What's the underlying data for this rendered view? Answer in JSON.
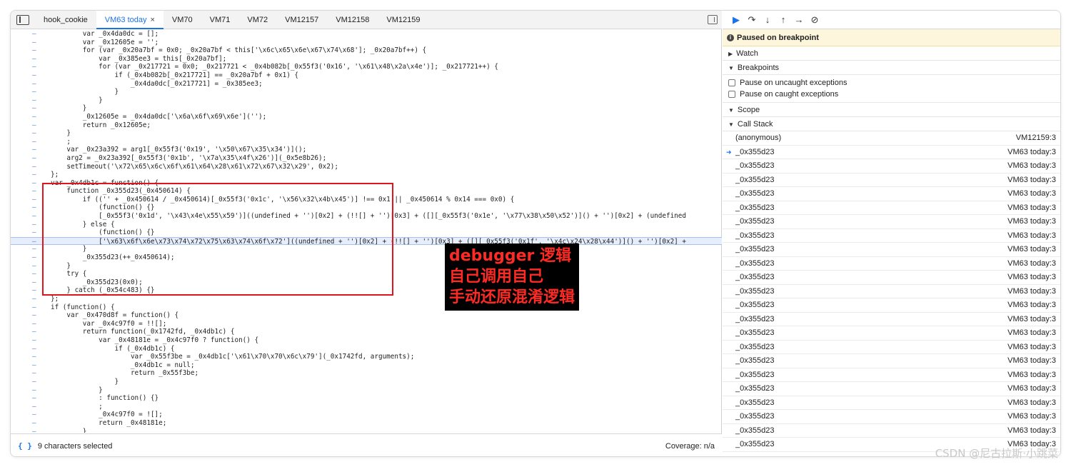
{
  "tabs": [
    {
      "label": "hook_cookie",
      "active": false
    },
    {
      "label": "VM63 today",
      "active": true
    },
    {
      "label": "VM70",
      "active": false
    },
    {
      "label": "VM71",
      "active": false
    },
    {
      "label": "VM72",
      "active": false
    },
    {
      "label": "VM12157",
      "active": false
    },
    {
      "label": "VM12158",
      "active": false
    },
    {
      "label": "VM12159",
      "active": false
    }
  ],
  "tab_close": "×",
  "code_lines": [
    {
      "text": "        var _0x4da0dc = [];"
    },
    {
      "text": "        var _0x12605e = '';"
    },
    {
      "text": "        for (var _0x20a7bf = 0x0; _0x20a7bf < this['\\x6c\\x65\\x6e\\x67\\x74\\x68']; _0x20a7bf++) {"
    },
    {
      "text": "            var _0x385ee3 = this[_0x20a7bf];"
    },
    {
      "text": "            for (var _0x217721 = 0x0; _0x217721 < _0x4b082b[_0x55f3('0x16', '\\x61\\x48\\x2a\\x4e')]; _0x217721++) {"
    },
    {
      "text": "                if (_0x4b082b[_0x217721] == _0x20a7bf + 0x1) {"
    },
    {
      "text": "                    _0x4da0dc[_0x217721] = _0x385ee3;"
    },
    {
      "text": "                }"
    },
    {
      "text": "            }"
    },
    {
      "text": "        }"
    },
    {
      "text": "        _0x12605e = _0x4da0dc['\\x6a\\x6f\\x69\\x6e']('');"
    },
    {
      "text": "        return _0x12605e;"
    },
    {
      "text": "    }"
    },
    {
      "text": "    ;"
    },
    {
      "text": "    var _0x23a392 = arg1[_0x55f3('0x19', '\\x50\\x67\\x35\\x34')]();"
    },
    {
      "text": "    arg2 = _0x23a392[_0x55f3('0x1b', '\\x7a\\x35\\x4f\\x26')](_0x5e8b26);"
    },
    {
      "text": "    setTimeout('\\x72\\x65\\x6c\\x6f\\x61\\x64\\x28\\x61\\x72\\x67\\x32\\x29', 0x2);"
    },
    {
      "text": "};"
    },
    {
      "text": "var _0x4db1c = function() {"
    },
    {
      "text": "    function _0x355d23(_0x450614) {"
    },
    {
      "text": "        if (('' + _0x450614 / _0x450614)[_0x55f3('0x1c', '\\x56\\x32\\x4b\\x45')] !== 0x1 || _0x450614 % 0x14 === 0x0) {"
    },
    {
      "text": "            (function() {}"
    },
    {
      "text": "            [_0x55f3('0x1d', '\\x43\\x4e\\x55\\x59')]((undefined + '')[0x2] + (!![] + '')[0x3] + ([][_0x55f3('0x1e', '\\x77\\x38\\x50\\x52')]() + '')[0x2] + (undefined"
    },
    {
      "text": "        } else {"
    },
    {
      "text": "            (function() {}"
    },
    {
      "text": "            ['\\x63\\x6f\\x6e\\x73\\x74\\x72\\x75\\x63\\x74\\x6f\\x72']((undefined + '')[0x2] + (!![] + '')[0x3] + ([][_0x55f3('0x1f', '\\x4c\\x24\\x28\\x44')]() + '')[0x2] +",
      "highlight": true
    },
    {
      "text": "        }"
    },
    {
      "text": "        _0x355d23(++_0x450614);"
    },
    {
      "text": "    }"
    },
    {
      "text": "    try {"
    },
    {
      "text": "        _0x355d23(0x0);"
    },
    {
      "text": "    } catch (_0x54c483) {}"
    },
    {
      "text": "};"
    },
    {
      "text": "if (function() {"
    },
    {
      "text": "    var _0x470d8f = function() {"
    },
    {
      "text": "        var _0x4c97f0 = !![];"
    },
    {
      "text": "        return function(_0x1742fd, _0x4db1c) {"
    },
    {
      "text": "            var _0x48181e = _0x4c97f0 ? function() {"
    },
    {
      "text": "                if (_0x4db1c) {"
    },
    {
      "text": "                    var _0x55f3be = _0x4db1c['\\x61\\x70\\x70\\x6c\\x79'](_0x1742fd, arguments);"
    },
    {
      "text": "                    _0x4db1c = null;"
    },
    {
      "text": "                    return _0x55f3be;"
    },
    {
      "text": "                }"
    },
    {
      "text": "            }"
    },
    {
      "text": "            : function() {}"
    },
    {
      "text": "            ;"
    },
    {
      "text": "            _0x4c97f0 = ![];"
    },
    {
      "text": "            return _0x48181e;"
    },
    {
      "text": "        }"
    }
  ],
  "gutter_mark": "–",
  "annotation": {
    "line1": "debugger 逻辑",
    "line2": "自己调用自己",
    "line3": "手动还原混淆逻辑"
  },
  "statusbar": {
    "braces": "{ }",
    "selection": "9 characters selected",
    "coverage": "Coverage: n/a"
  },
  "right_panel": {
    "paused_text": "Paused on breakpoint",
    "watch": "Watch",
    "breakpoints": "Breakpoints",
    "pause_uncaught": "Pause on uncaught exceptions",
    "pause_caught": "Pause on caught exceptions",
    "scope": "Scope",
    "call_stack": "Call Stack"
  },
  "call_stack": [
    {
      "fn": "(anonymous)",
      "loc": "VM12159:3",
      "current": false
    },
    {
      "fn": "_0x355d23",
      "loc": "VM63 today:3",
      "current": true
    },
    {
      "fn": "_0x355d23",
      "loc": "VM63 today:3",
      "current": false
    },
    {
      "fn": "_0x355d23",
      "loc": "VM63 today:3",
      "current": false
    },
    {
      "fn": "_0x355d23",
      "loc": "VM63 today:3",
      "current": false
    },
    {
      "fn": "_0x355d23",
      "loc": "VM63 today:3",
      "current": false
    },
    {
      "fn": "_0x355d23",
      "loc": "VM63 today:3",
      "current": false
    },
    {
      "fn": "_0x355d23",
      "loc": "VM63 today:3",
      "current": false
    },
    {
      "fn": "_0x355d23",
      "loc": "VM63 today:3",
      "current": false
    },
    {
      "fn": "_0x355d23",
      "loc": "VM63 today:3",
      "current": false
    },
    {
      "fn": "_0x355d23",
      "loc": "VM63 today:3",
      "current": false
    },
    {
      "fn": "_0x355d23",
      "loc": "VM63 today:3",
      "current": false
    },
    {
      "fn": "_0x355d23",
      "loc": "VM63 today:3",
      "current": false
    },
    {
      "fn": "_0x355d23",
      "loc": "VM63 today:3",
      "current": false
    },
    {
      "fn": "_0x355d23",
      "loc": "VM63 today:3",
      "current": false
    },
    {
      "fn": "_0x355d23",
      "loc": "VM63 today:3",
      "current": false
    },
    {
      "fn": "_0x355d23",
      "loc": "VM63 today:3",
      "current": false
    },
    {
      "fn": "_0x355d23",
      "loc": "VM63 today:3",
      "current": false
    },
    {
      "fn": "_0x355d23",
      "loc": "VM63 today:3",
      "current": false
    },
    {
      "fn": "_0x355d23",
      "loc": "VM63 today:3",
      "current": false
    },
    {
      "fn": "_0x355d23",
      "loc": "VM63 today:3",
      "current": false
    },
    {
      "fn": "_0x355d23",
      "loc": "VM63 today:3",
      "current": false
    },
    {
      "fn": "_0x355d23",
      "loc": "VM63 today:3",
      "current": false
    }
  ],
  "watermark": "CSDN @尼古拉斯·小跳菜",
  "colors": {
    "accent": "#1a73e8",
    "annotation_text": "#ff2a24",
    "annotation_bg": "#000000",
    "red_box": "#e0141c",
    "paused_bg": "#fdf6dd"
  },
  "icons": {
    "toggle_navigator": "sidebar-toggle-icon",
    "toggle_debugger": "sidebar-right-icon",
    "resume": "resume-icon",
    "step_over": "step-over-icon",
    "step_into": "step-into-icon",
    "step_out": "step-out-icon",
    "step": "step-icon",
    "deactivate_breakpoints": "deactivate-breakpoints-icon"
  }
}
